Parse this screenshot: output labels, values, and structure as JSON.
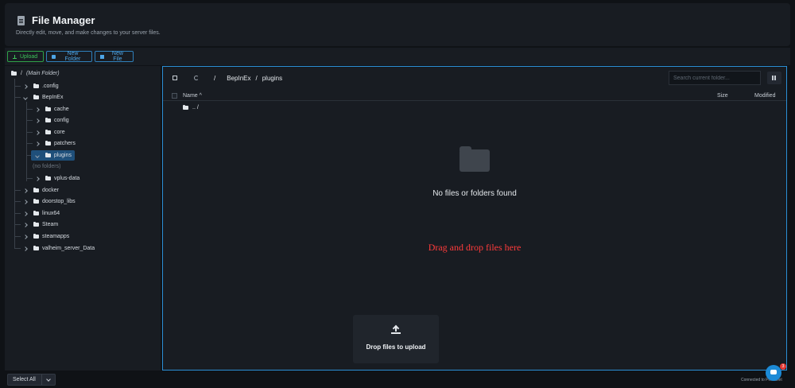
{
  "header": {
    "title": "File Manager",
    "subtitle": "Directly edit, move, and make changes to your server files."
  },
  "toolbar": {
    "upload_label": "Upload",
    "new_folder_label": "New Folder",
    "new_file_label": "New File"
  },
  "sidebar": {
    "root_slash": "/",
    "root_label": "(Main Folder)",
    "items": [
      {
        "label": ".config"
      },
      {
        "label": "BepInEx"
      },
      {
        "label": "cache"
      },
      {
        "label": "config"
      },
      {
        "label": "core"
      },
      {
        "label": "patchers"
      },
      {
        "label": "plugins"
      },
      {
        "label": "(no folders)"
      },
      {
        "label": "vplus-data"
      },
      {
        "label": "docker"
      },
      {
        "label": "doorstop_libs"
      },
      {
        "label": "linux64"
      },
      {
        "label": "Steam"
      },
      {
        "label": "steamapps"
      },
      {
        "label": "valheim_server_Data"
      }
    ]
  },
  "main": {
    "breadcrumb": {
      "root": "/",
      "part1": "BepInEx",
      "sep": "/",
      "part2": "plugins"
    },
    "search_placeholder": "Search current folder...",
    "columns": {
      "name": "Name",
      "size": "Size",
      "modified": "Modified"
    },
    "sort_indicator": "^",
    "parent_row": ".. /",
    "empty_message": "No files or folders found",
    "drag_drop": "Drag and drop files here",
    "drop_upload": "Drop files to upload"
  },
  "footer": {
    "select_all": "Select All",
    "connected": "Connected to Pelicanet",
    "chat_badge": "3"
  },
  "colors": {
    "accent": "#2b8fd6",
    "success": "#3ec45a",
    "danger": "#ff3b3b",
    "selected": "#1f4f7a"
  }
}
